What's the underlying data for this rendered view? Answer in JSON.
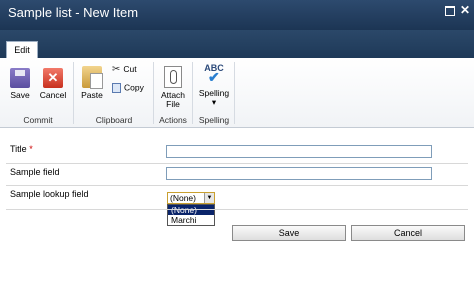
{
  "window": {
    "title": "Sample list - New Item",
    "close_glyph": "✕",
    "colors": {
      "titlebar": "#1c3554",
      "accent": "#0a246a",
      "required": "#cc0000"
    }
  },
  "ribbon": {
    "tabs": [
      {
        "label": "Edit",
        "active": true
      }
    ],
    "groups": {
      "commit": {
        "label": "Commit",
        "save": "Save",
        "cancel": "Cancel"
      },
      "clipboard": {
        "label": "Clipboard",
        "paste": "Paste",
        "cut": "Cut",
        "copy": "Copy"
      },
      "actions": {
        "label": "Actions",
        "attach_line1": "Attach",
        "attach_line2": "File"
      },
      "spelling": {
        "label": "Spelling",
        "spelling": "Spelling",
        "spell_icon_text": "ABC"
      }
    }
  },
  "form": {
    "fields": [
      {
        "label": "Title",
        "required_marker": "*",
        "value": ""
      },
      {
        "label": "Sample field",
        "value": ""
      },
      {
        "label": "Sample lookup field",
        "selected": "(None)",
        "options": [
          "(None)",
          "Marchi"
        ]
      }
    ],
    "save_button": "Save",
    "cancel_button": "Cancel"
  }
}
